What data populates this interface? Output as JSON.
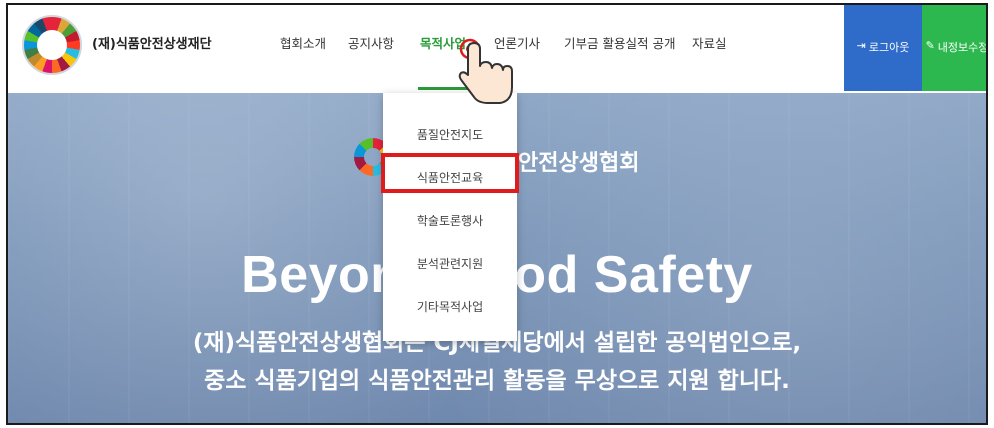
{
  "header": {
    "org_name": "(재)식품안전상생재단",
    "nav": [
      {
        "label": "협회소개"
      },
      {
        "label": "공지사항"
      },
      {
        "label": "목적사업",
        "active": true
      },
      {
        "label": "언론기사"
      },
      {
        "label": "기부금 활용실적 공개"
      },
      {
        "label": "자료실"
      }
    ],
    "logout_label": "로그아웃",
    "profile_label": "내정보수정"
  },
  "dropdown": {
    "items": [
      "품질안전지도",
      "식품안전교육",
      "학술토론행사",
      "분석관련지원",
      "기타목적사업"
    ],
    "highlighted_index": 1
  },
  "hero": {
    "association_suffix": "안전상생협회",
    "title": "Beyond Food Safety",
    "line1": "(재)식품안전상생협회는 CJ제일제당에서 설립한 공익법인으로,",
    "line2": "중소 식품기업의 식품안전관리 활동을 무상으로 지원 합니다."
  },
  "colors": {
    "accent_green": "#2a9a3a",
    "logout_bg": "#2f6bc9",
    "profile_bg": "#2db84f",
    "highlight_red": "#e01b1b"
  },
  "icons": {
    "logo": "sdg-wheel-logo",
    "logout": "logout-icon",
    "profile": "pencil-icon",
    "cursor": "hand-pointer-icon"
  }
}
